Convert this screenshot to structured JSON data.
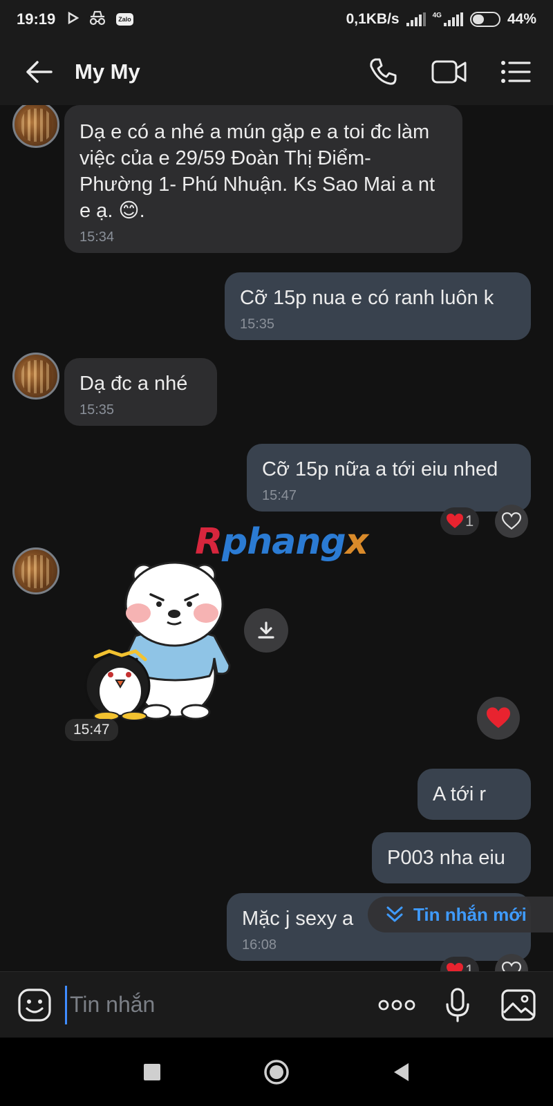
{
  "status_bar": {
    "time": "19:19",
    "app_badge": "Zalo",
    "net_speed": "0,1KB/s",
    "network_type": "4G",
    "battery": "44%",
    "battery_level": 0.44,
    "icons": [
      "play-icon",
      "incognito-icon",
      "zalo-icon",
      "signal-icon",
      "signal-4g-icon",
      "battery-icon"
    ]
  },
  "header": {
    "title": "My My",
    "icons": [
      "back-arrow-icon",
      "phone-icon",
      "video-call-icon",
      "menu-list-icon"
    ]
  },
  "messages": [
    {
      "id": 1,
      "direction": "in",
      "text": "Dạ e có a nhé a mún gặp e a toi đc làm việc của e 29/59 Đoàn Thị Điểm- Phường 1- Phú Nhuận. Ks Sao Mai a nt e ạ. 😊.",
      "time": "15:34"
    },
    {
      "id": 2,
      "direction": "out",
      "text": "Cỡ 15p nua e có ranh luôn k",
      "time": "15:35"
    },
    {
      "id": 3,
      "direction": "in",
      "text": "Dạ đc a nhé",
      "time": "15:35"
    },
    {
      "id": 4,
      "direction": "out",
      "text": "Cỡ 15p nữa a tới eiu nhed",
      "time": "15:47",
      "reaction_count": "1"
    },
    {
      "id": 5,
      "direction": "in",
      "type": "sticker",
      "time": "15:47"
    },
    {
      "id": 6,
      "direction": "out",
      "text": "A tới r"
    },
    {
      "id": 7,
      "direction": "out",
      "text": "P003 nha eiu"
    },
    {
      "id": 8,
      "direction": "out",
      "text": "Mặc j sexy a",
      "time": "16:08",
      "reaction_count": "1"
    }
  ],
  "watermark": "Rphangx",
  "new_message_pill": {
    "label": "Tin nhắn mới",
    "icon": "double-chevron-down-icon"
  },
  "input_bar": {
    "placeholder": "Tin nhắn",
    "icons": [
      "emoji-icon",
      "more-dots-icon",
      "microphone-icon",
      "gallery-icon"
    ]
  },
  "nav_bar": {
    "icons": [
      "recents-square-icon",
      "home-circle-icon",
      "back-triangle-icon"
    ]
  },
  "colors": {
    "background": "#121212",
    "bar": "#1b1b1b",
    "incoming_bubble": "#2d2d2f",
    "outgoing_bubble": "#39424e",
    "accent_blue": "#3f9bff",
    "heart_red": "#e8232f"
  }
}
